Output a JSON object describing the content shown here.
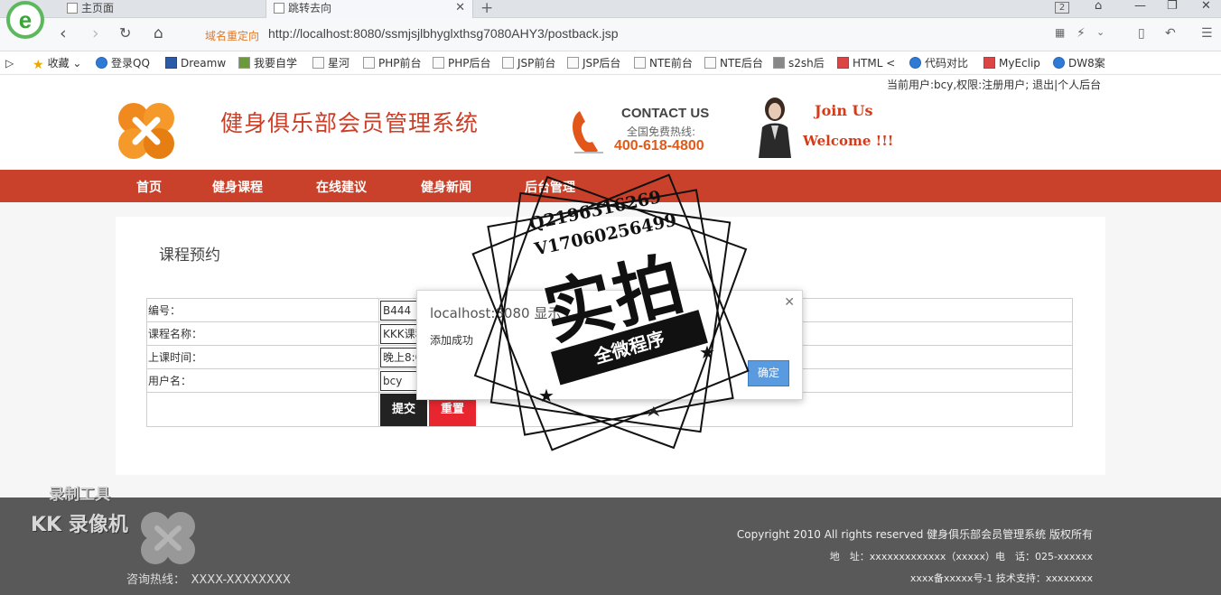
{
  "browser": {
    "tabs": [
      {
        "label": "主页面"
      },
      {
        "label": "跳转去向"
      }
    ],
    "tab_count": "2",
    "redirect_label": "域名重定向",
    "url": "http://localhost:8080/ssmjsjlbhyglxthsg7080AHY3/postback.jsp",
    "bookmarks": [
      {
        "label": "收藏",
        "icon": "star-icon"
      },
      {
        "label": "登录QQ",
        "icon": "globe-icon"
      },
      {
        "label": "Dreamw",
        "icon": "dreamweaver-icon"
      },
      {
        "label": "我要自学",
        "icon": "page-icon"
      },
      {
        "label": "星河",
        "icon": "page-icon"
      },
      {
        "label": "PHP前台",
        "icon": "page-icon"
      },
      {
        "label": "PHP后台",
        "icon": "page-icon"
      },
      {
        "label": "JSP前台",
        "icon": "page-icon"
      },
      {
        "label": "JSP后台",
        "icon": "page-icon"
      },
      {
        "label": "NTE前台",
        "icon": "page-icon"
      },
      {
        "label": "NTE后台",
        "icon": "page-icon"
      },
      {
        "label": "s2sh后",
        "icon": "page-icon"
      },
      {
        "label": "HTML <",
        "icon": "html-icon"
      },
      {
        "label": "代码对比",
        "icon": "globe-icon"
      },
      {
        "label": "MyEclip",
        "icon": "myeclipse-icon"
      },
      {
        "label": "DW8案",
        "icon": "globe-icon"
      }
    ]
  },
  "header": {
    "user_info": "当前用户:bcy,权限:注册用户; 退出|个人后台",
    "site_title": "健身俱乐部会员管理系统",
    "contact_us": "CONTACT US",
    "contact_sub": "全国免费热线:",
    "contact_phone": "400-618-4800",
    "join_us": "Join Us",
    "welcome": "Welcome !!!"
  },
  "nav": [
    {
      "label": "首页"
    },
    {
      "label": "健身课程"
    },
    {
      "label": "在线建议"
    },
    {
      "label": "健身新闻"
    },
    {
      "label": "后台管理"
    }
  ],
  "form": {
    "title": "课程预约",
    "fields": [
      {
        "label": "编号：",
        "value": "B444"
      },
      {
        "label": "课程名称：",
        "value": "KKK课程"
      },
      {
        "label": "上课时间：",
        "value": "晚上8:00-10:00"
      },
      {
        "label": "用户名：",
        "value": "bcy"
      }
    ],
    "submit_label": "提交",
    "reset_label": "重置"
  },
  "dialog": {
    "title": "localhost:8080 显示",
    "message": "添加成功",
    "ok_label": "确定"
  },
  "footer": {
    "copyright": "Copyright 2010 All rights reserved 健身俱乐部会员管理系统 版权所有",
    "address": "地　址：xxxxxxxxxxxxx（xxxxx）电　话：025-xxxxxx",
    "icp": "xxxx备xxxxx号-1 技术支持：xxxxxxxx",
    "hotline": "咨询热线：　XXXX-XXXXXXXX"
  },
  "overlay": {
    "stamp_line1": "Q2196316269",
    "stamp_line2": "V17060256499",
    "stamp_main": "实拍",
    "stamp_ribbon": "全微程序",
    "recorder_tool": "录制工具",
    "recorder_name": "KK 录像机"
  },
  "colors": {
    "accent": "#c9412b",
    "title_red": "#c8402a",
    "submit_bg": "#222222",
    "reset_bg": "#e8262f",
    "dialog_ok": "#5a9be0",
    "footer_bg": "#595959"
  }
}
